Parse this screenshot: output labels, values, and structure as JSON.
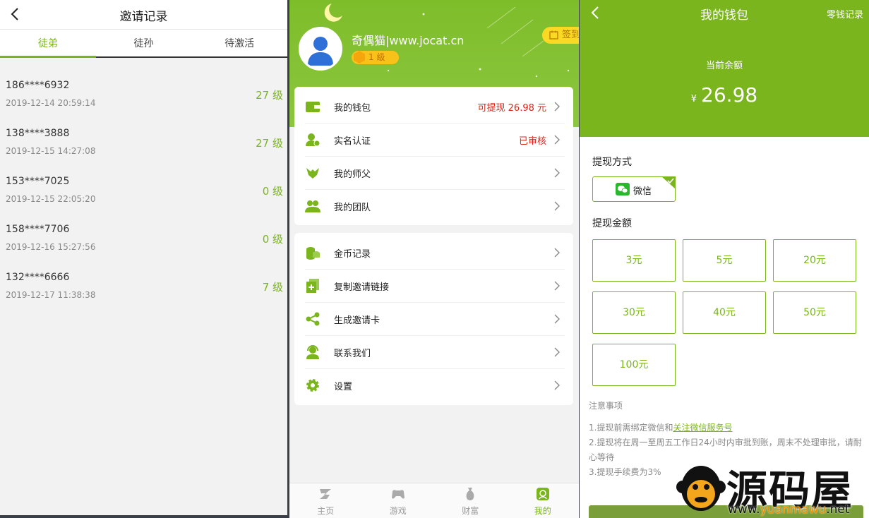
{
  "invite": {
    "title": "邀请记录",
    "tabs": [
      "徒弟",
      "徒孙",
      "待激活"
    ],
    "active_tab": 0,
    "records": [
      {
        "phone": "186****6932",
        "date": "2019-12-14 20:59:14",
        "level": "27 级"
      },
      {
        "phone": "138****3888",
        "date": "2019-12-15 14:27:08",
        "level": "27 级"
      },
      {
        "phone": "153****7025",
        "date": "2019-12-15 22:05:20",
        "level": "0 级"
      },
      {
        "phone": "158****7706",
        "date": "2019-12-16 15:27:56",
        "level": "0 级"
      },
      {
        "phone": "132****6666",
        "date": "2019-12-17 11:38:38",
        "level": "7 级"
      }
    ]
  },
  "profile": {
    "username": "奇偶猫|www.jocat.cn",
    "level": "1 级",
    "signin": "签到",
    "menu1": [
      {
        "icon": "wallet-icon",
        "label": "我的钱包",
        "value": "可提现 26.98 元"
      },
      {
        "icon": "user-verify-icon",
        "label": "实名认证",
        "value": "已审核"
      },
      {
        "icon": "master-icon",
        "label": "我的师父",
        "value": ""
      },
      {
        "icon": "team-icon",
        "label": "我的团队",
        "value": ""
      }
    ],
    "menu2": [
      {
        "icon": "coins-icon",
        "label": "金币记录"
      },
      {
        "icon": "copy-link-icon",
        "label": "复制邀请链接"
      },
      {
        "icon": "share-icon",
        "label": "生成邀请卡"
      },
      {
        "icon": "support-icon",
        "label": "联系我们"
      },
      {
        "icon": "settings-icon",
        "label": "设置"
      }
    ],
    "tabbar": [
      {
        "icon": "home-icon",
        "label": "主页"
      },
      {
        "icon": "gamepad-icon",
        "label": "游戏"
      },
      {
        "icon": "money-bag-icon",
        "label": "财富"
      },
      {
        "icon": "me-icon",
        "label": "我的"
      }
    ],
    "active_tab": 3
  },
  "wallet": {
    "title": "我的钱包",
    "record_link": "零钱记录",
    "balance_label": "当前余额",
    "currency": "¥",
    "balance": "26.98",
    "method_title": "提现方式",
    "method": "微信",
    "amount_title": "提现金额",
    "amounts": [
      "3元",
      "5元",
      "20元",
      "30元",
      "40元",
      "50元",
      "100元"
    ],
    "notes_title": "注意事项",
    "note1_prefix": "1.提现前需绑定微信和",
    "note1_link": "关注微信服务号",
    "note2": "2.提现将在周一至周五工作日24小时内审批到账，周末不处理审批，请耐心等待",
    "note3": "3.提现手续费为3%"
  },
  "watermark": {
    "brand": "源码屋",
    "url_prefix": "www.",
    "url_mid": "yuanmawu",
    "url_suffix": ".net"
  },
  "colors": {
    "accent": "#7ab51d",
    "alert": "#d9261c",
    "signin": "#f9d923"
  }
}
